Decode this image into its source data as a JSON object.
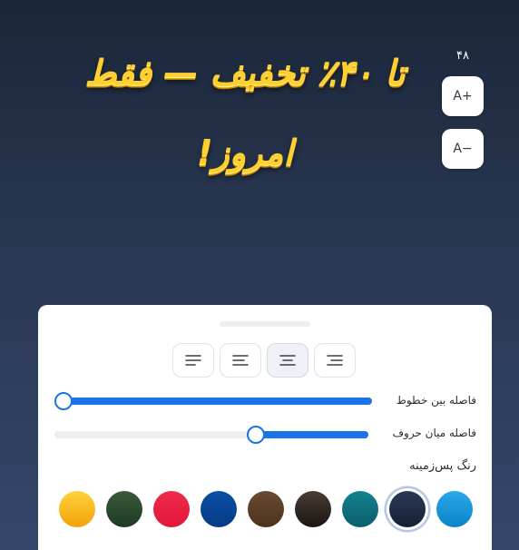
{
  "banner": {
    "line1": "تا ۴۰٪ تخفیف — فقط",
    "line2": "امروز!"
  },
  "font_size": {
    "value": "۴۸",
    "increase_label": "A+",
    "decrease_label": "A−"
  },
  "alignment": {
    "options": [
      "align-left",
      "align-left-short",
      "align-center",
      "align-right"
    ],
    "selected": "align-center"
  },
  "line_spacing": {
    "label": "فاصله بین خطوط",
    "level_fraction": 0.0
  },
  "letter_spacing": {
    "label": "فاصله میان حروف",
    "level_fraction": 0.65
  },
  "background": {
    "title": "رنگ پس‌زمینه",
    "swatches": [
      {
        "name": "yellow",
        "colors": [
          "#ffd23a",
          "#f4a10a"
        ]
      },
      {
        "name": "dark-green",
        "colors": [
          "#3a5a3a",
          "#1e3a24"
        ]
      },
      {
        "name": "red",
        "colors": [
          "#ee2a4a",
          "#e2173a"
        ]
      },
      {
        "name": "blue",
        "colors": [
          "#0a4ea6",
          "#073b86"
        ]
      },
      {
        "name": "brown",
        "colors": [
          "#6b4a30",
          "#4c321c"
        ]
      },
      {
        "name": "dark-brown",
        "colors": [
          "#4a3d33",
          "#1b1512"
        ]
      },
      {
        "name": "teal",
        "colors": [
          "#13838f",
          "#0b5e6b"
        ]
      },
      {
        "name": "navy",
        "colors": [
          "#2a3a56",
          "#172033"
        ]
      },
      {
        "name": "sky-blue",
        "colors": [
          "#2aa8ea",
          "#0a84c8"
        ]
      }
    ],
    "selected": "navy"
  }
}
